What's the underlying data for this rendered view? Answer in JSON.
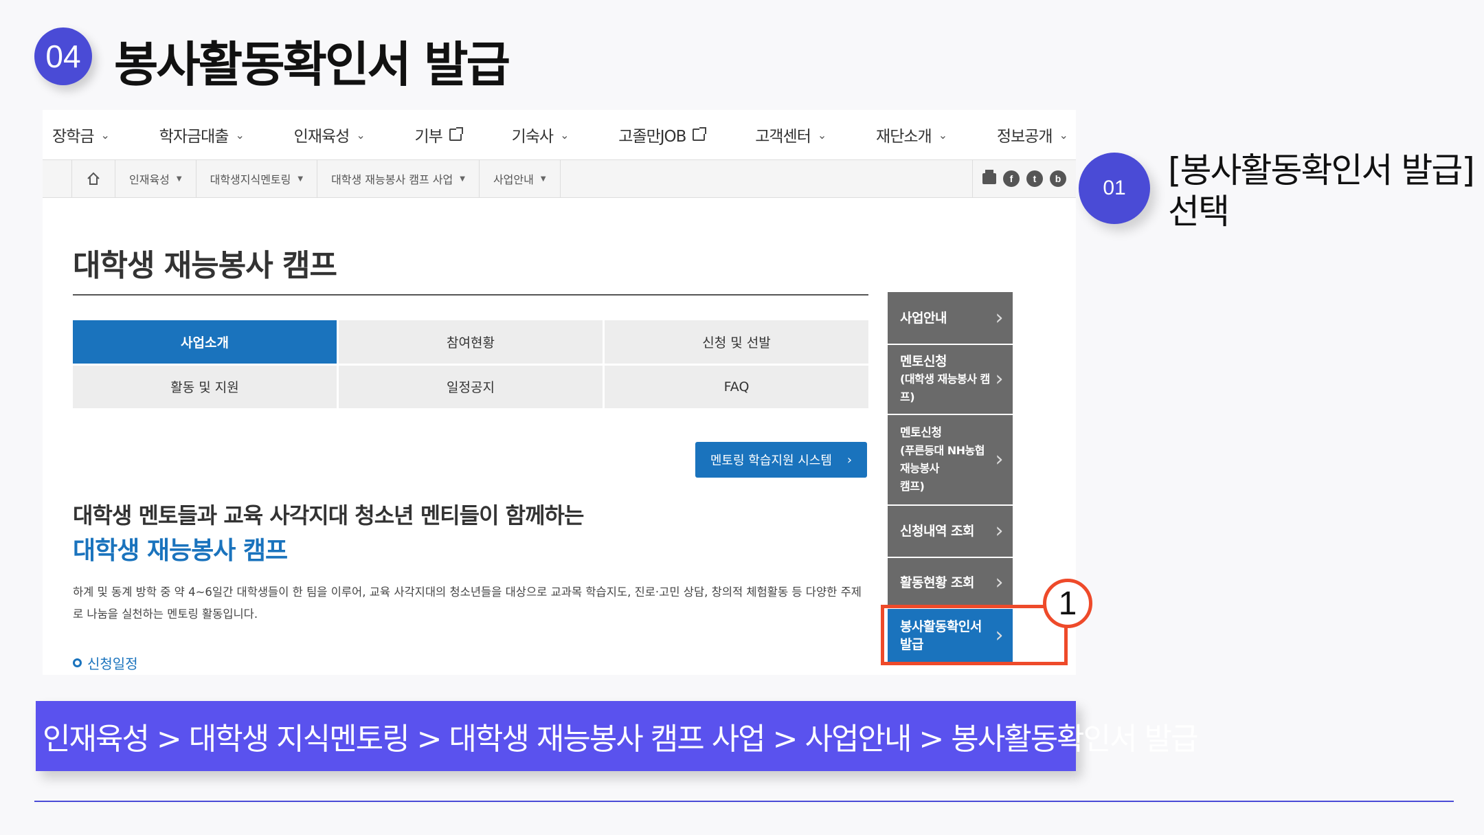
{
  "slide": {
    "step_number": "04",
    "title": "봉사활동확인서 발급"
  },
  "gnb": [
    {
      "label": "장학금",
      "icon": "chevron-down-icon"
    },
    {
      "label": "학자금대출",
      "icon": "chevron-down-icon"
    },
    {
      "label": "인재육성",
      "icon": "chevron-down-icon"
    },
    {
      "label": "기부",
      "icon": "external-link-icon"
    },
    {
      "label": "기숙사",
      "icon": "chevron-down-icon"
    },
    {
      "label": "고졸만JOB",
      "icon": "external-link-icon"
    },
    {
      "label": "고객센터",
      "icon": "chevron-down-icon"
    },
    {
      "label": "재단소개",
      "icon": "chevron-down-icon"
    },
    {
      "label": "정보공개",
      "icon": "chevron-down-icon"
    }
  ],
  "breadcrumb": {
    "home_icon": "home-icon",
    "items": [
      "인재육성",
      "대학생지식멘토링",
      "대학생 재능봉사 캠프 사업",
      "사업안내"
    ],
    "tools": {
      "print": "print-icon",
      "facebook": "f",
      "twitter": "t",
      "blog": "b"
    }
  },
  "page": {
    "heading": "대학생 재능봉사 캠프",
    "tabs": [
      "사업소개",
      "참여현황",
      "신청 및 선발",
      "활동 및 지원",
      "일정공지",
      "FAQ"
    ],
    "active_tab": "사업소개",
    "system_button": "멘토링 학습지원 시스템",
    "intro_line1": "대학생 멘토들과 교육 사각지대 청소년 멘티들이 함께하는",
    "intro_line2": "대학생 재능봉사 캠프",
    "description": "하계 및 동계 방학 중 약 4~6일간 대학생들이 한 팀을 이루어, 교육 사각지대의 청소년들을 대상으로 교과목 학습지도, 진로·고민 상담, 창의적 체험활동 등 다양한 주제로 나눔을 실천하는 멘토링 활동입니다.",
    "schedule_label": "신청일정"
  },
  "side_menu": [
    {
      "line1": "사업안내",
      "line2": "",
      "line3": ""
    },
    {
      "line1": "멘토신청",
      "line2": "(대학생 재능봉사 캠프)",
      "line3": ""
    },
    {
      "line1": "멘토신청",
      "line2": "(푸른등대 NH농협 재능봉사",
      "line3": "캠프)"
    },
    {
      "line1": "신청내역 조회",
      "line2": "",
      "line3": ""
    },
    {
      "line1": "활동현황 조회",
      "line2": "",
      "line3": ""
    },
    {
      "line1": "봉사활동확인서 발급",
      "line2": "",
      "line3": ""
    }
  ],
  "annotation": {
    "marker": "1",
    "step_badge": "01",
    "step_text_line1": "[봉사활동확인서 발급]",
    "step_text_line2": "선택",
    "highlight_color": "#ee4a2a"
  },
  "path_bar": {
    "text": "인재육성 > 대학생 지식멘토링 > 대학생 재능봉사 캠프 사업 > 사업안내 > 봉사활동확인서 발급"
  },
  "colors": {
    "accent": "#4a4bd6",
    "site_blue": "#1a73bd",
    "path_bar": "#5a52ee",
    "side_gray": "#6a6a6a"
  }
}
